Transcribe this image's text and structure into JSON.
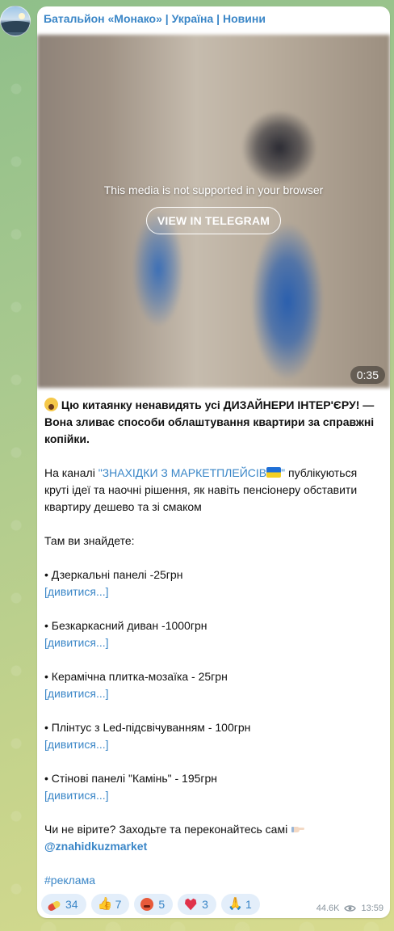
{
  "channel": {
    "name": "Батальйон «Монако» | Україна | Новини"
  },
  "media": {
    "unsupported_message": "This media is not supported in your browser",
    "view_button_label": "VIEW IN TELEGRAM",
    "duration": "0:35"
  },
  "post": {
    "headline": "Цю китаянку ненавидять усі ДИЗАЙНЕРИ ІНТЕР'ЄРУ! — Вона зливає способи облаштування квартири за справжні копійки.",
    "intro_prefix": "На каналі ",
    "intro_link": "\"ЗНАХІДКИ З МАРКЕТПЛЕЙСІВ",
    "intro_link_suffix": "\"",
    "intro_rest": " публікуються круті ідеї та наочні рішення, як навіть пенсіонеру обставити квартиру дешево та зі смаком",
    "list_heading": "Там ви знайдете:",
    "items": [
      {
        "text": "• Дзеркальні панелі -25грн",
        "link": "[дивитися...]"
      },
      {
        "text": "• Безкаркасний диван -1000грн",
        "link": "[дивитися...]"
      },
      {
        "text": "• Керамічна плитка-мозаїка - 25грн",
        "link": "[дивитися...]"
      },
      {
        "text": "• Плінтус з Led-підсвічуванням - 100грн",
        "link": "[дивитися...]"
      },
      {
        "text": "• Стінові панелі \"Камінь\" - 195грн",
        "link": "[дивитися...]"
      }
    ],
    "cta": "Чи не вірите? Заходьте та переконайтесь самі ",
    "handle": "@znahidkuzmarket",
    "hashtag": "#реклама"
  },
  "reactions": [
    {
      "icon": "pill-icon",
      "count": "34"
    },
    {
      "icon": "thumbs-up-icon",
      "count": "7"
    },
    {
      "icon": "angry-face-icon",
      "count": "5"
    },
    {
      "icon": "heart-on-fire-icon",
      "count": "3"
    },
    {
      "icon": "folded-hands-icon",
      "count": "1"
    }
  ],
  "meta": {
    "views": "44.6K",
    "time": "13:59"
  },
  "colors": {
    "link": "#3a86c7",
    "reaction_bg": "#e3eefa"
  }
}
